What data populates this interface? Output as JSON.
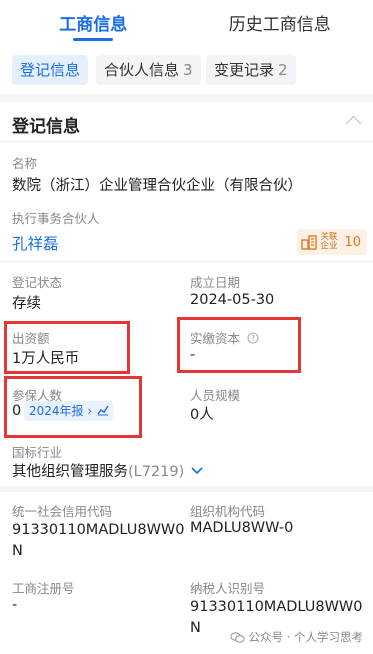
{
  "tabs": [
    {
      "label": "工商信息",
      "active": true
    },
    {
      "label": "历史工商信息",
      "active": false
    }
  ],
  "chips": [
    {
      "label": "登记信息",
      "count": "",
      "active": true
    },
    {
      "label": "合伙人信息",
      "count": "3",
      "active": false
    },
    {
      "label": "变更记录",
      "count": "2",
      "active": false
    }
  ],
  "section": {
    "title": "登记信息"
  },
  "fields": {
    "name": {
      "label": "名称",
      "value": "数院（浙江）企业管理合伙企业（有限合伙）"
    },
    "partner": {
      "label": "执行事务合伙人",
      "value": "孔祥磊",
      "related_text": "关联\n企业",
      "related_count": "10"
    },
    "status": {
      "label": "登记状态",
      "value": "存续"
    },
    "founded": {
      "label": "成立日期",
      "value": "2024-05-30"
    },
    "capital": {
      "label": "出资额",
      "value": "1万人民币"
    },
    "paid_capital": {
      "label": "实缴资本",
      "value": "-"
    },
    "insured": {
      "label": "参保人数",
      "value": "0",
      "badge": "2024年报"
    },
    "staff_size": {
      "label": "人员规模",
      "value": "0人"
    },
    "industry": {
      "label": "国标行业",
      "value": "其他组织管理服务",
      "code": "(L7219)"
    },
    "credit_code": {
      "label": "统一社会信用代码",
      "value_line1": "91330110MADLU8WW0",
      "value_line2": "N"
    },
    "org_code": {
      "label": "组织机构代码",
      "value": "MADLU8WW-0"
    },
    "reg_no": {
      "label": "工商注册号",
      "value": "-"
    },
    "tax_id": {
      "label": "纳税人识别号",
      "value_line1": "91330110MADLU8WW0",
      "value_line2": "N"
    }
  },
  "watermark": "公众号 · 个人学习思考",
  "colors": {
    "accent": "#1a6fe6",
    "highlight_box": "#e53535",
    "related": "#e07a1f"
  }
}
